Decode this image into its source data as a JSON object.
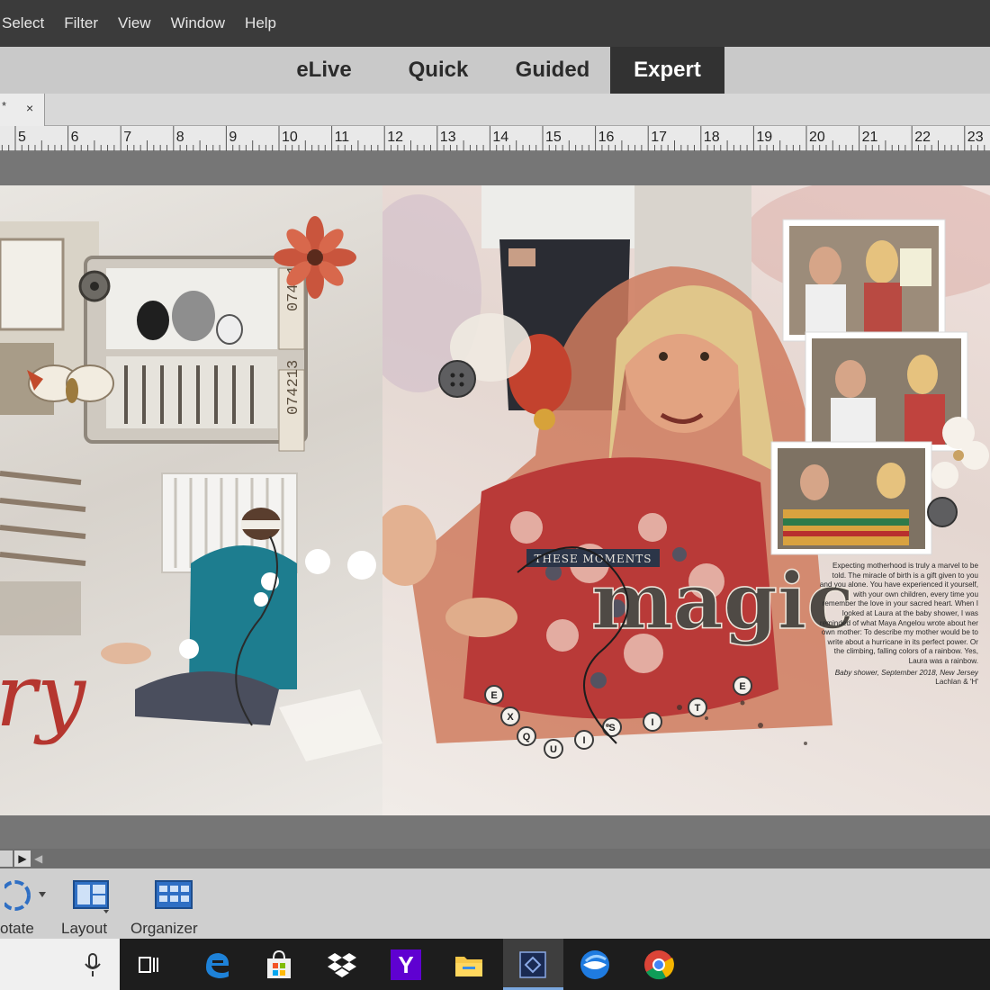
{
  "menu": [
    "Select",
    "Filter",
    "View",
    "Window",
    "Help"
  ],
  "modes": {
    "tabs": [
      {
        "label": "eLive",
        "active": false
      },
      {
        "label": "Quick",
        "active": false
      },
      {
        "label": "Guided",
        "active": false
      },
      {
        "label": "Expert",
        "active": true
      }
    ]
  },
  "document_tab": {
    "modified_marker": "*",
    "close": "×"
  },
  "ruler": {
    "labels": [
      "5",
      "6",
      "7",
      "8",
      "9",
      "10",
      "11",
      "12",
      "13",
      "14",
      "15",
      "16",
      "17",
      "18",
      "19",
      "20",
      "21",
      "22",
      "23"
    ]
  },
  "canvas": {
    "left_text": "ry",
    "sticker_label": "THESE MOMENTS",
    "title_word": "magic",
    "exquisite_letters": [
      "E",
      "X",
      "Q",
      "U",
      "I",
      "S",
      "I",
      "T",
      "E"
    ],
    "ticket_number": "074213",
    "journal": "Expecting motherhood is truly a marvel to be told. The miracle of birth is a gift given to you and you alone. You have experienced it yourself, with your own children, every time you remember the love in your sacred heart. When I looked at Laura at the baby shower, I was reminded of what Maya Angelou wrote about her own mother: To describe my mother would be to write about a hurricane in its perfect power. Or the climbing, falling colors of a rainbow. Yes, Laura was a rainbow.",
    "journal_caption": "Baby shower, September 2018, New Jersey",
    "journal_signoff": "Lachlan & 'H'"
  },
  "toolbar": {
    "tools": [
      {
        "icon": "rotate-icon",
        "label": "otate"
      },
      {
        "icon": "layout-icon",
        "label": "Layout"
      },
      {
        "icon": "organizer-icon",
        "label": "Organizer"
      }
    ]
  },
  "taskbar": {
    "icons": [
      "microphone-icon",
      "task-view-icon",
      "edge-icon",
      "store-icon",
      "dropbox-icon",
      "yahoo-icon",
      "file-explorer-icon",
      "photoshop-elements-icon",
      "thunderbird-icon",
      "chrome-icon"
    ],
    "yahoo_letter": "Y"
  },
  "colors": {
    "menubar": "#3b3b3b",
    "modebar": "#c9c9c9",
    "active_mode": "#323232",
    "canvas_bg": "#767676",
    "accent_red": "#b5362f",
    "taskbar": "#1d1d1d"
  }
}
